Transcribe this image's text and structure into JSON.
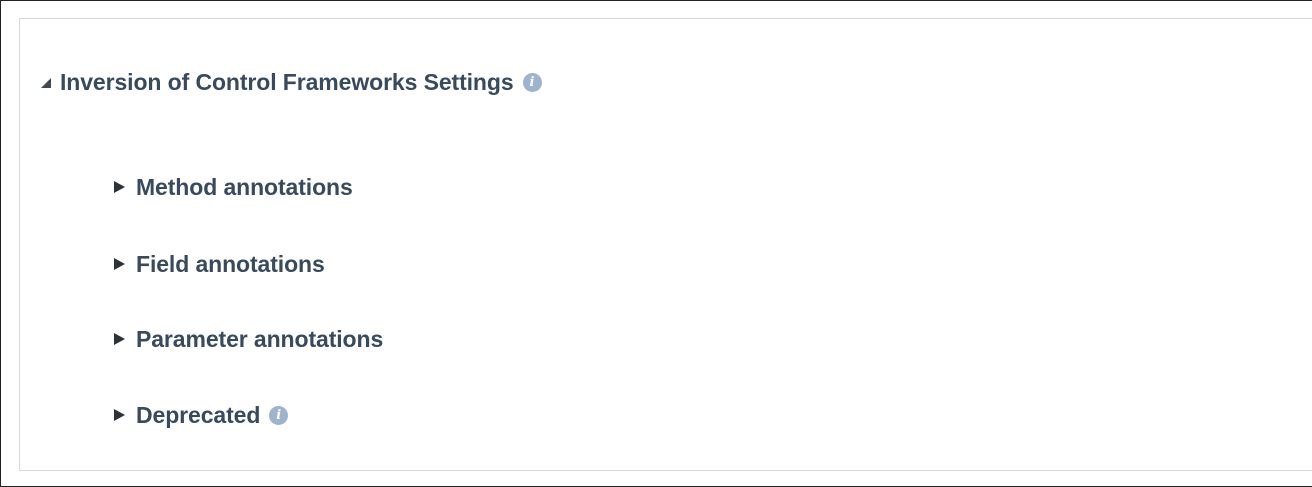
{
  "section": {
    "title": "Inversion of Control Frameworks Settings",
    "expanded": true,
    "info_icon": "info-icon"
  },
  "subsections": [
    {
      "label": "Method annotations",
      "expanded": false
    },
    {
      "label": "Field annotations",
      "expanded": false
    },
    {
      "label": "Parameter annotations",
      "expanded": false
    },
    {
      "label": "Deprecated",
      "expanded": false,
      "info_icon": "info-icon"
    }
  ],
  "colors": {
    "heading_text": "#384a5e",
    "info_icon_bg": "#9eb3cd",
    "panel_border": "#d9d9d9"
  }
}
